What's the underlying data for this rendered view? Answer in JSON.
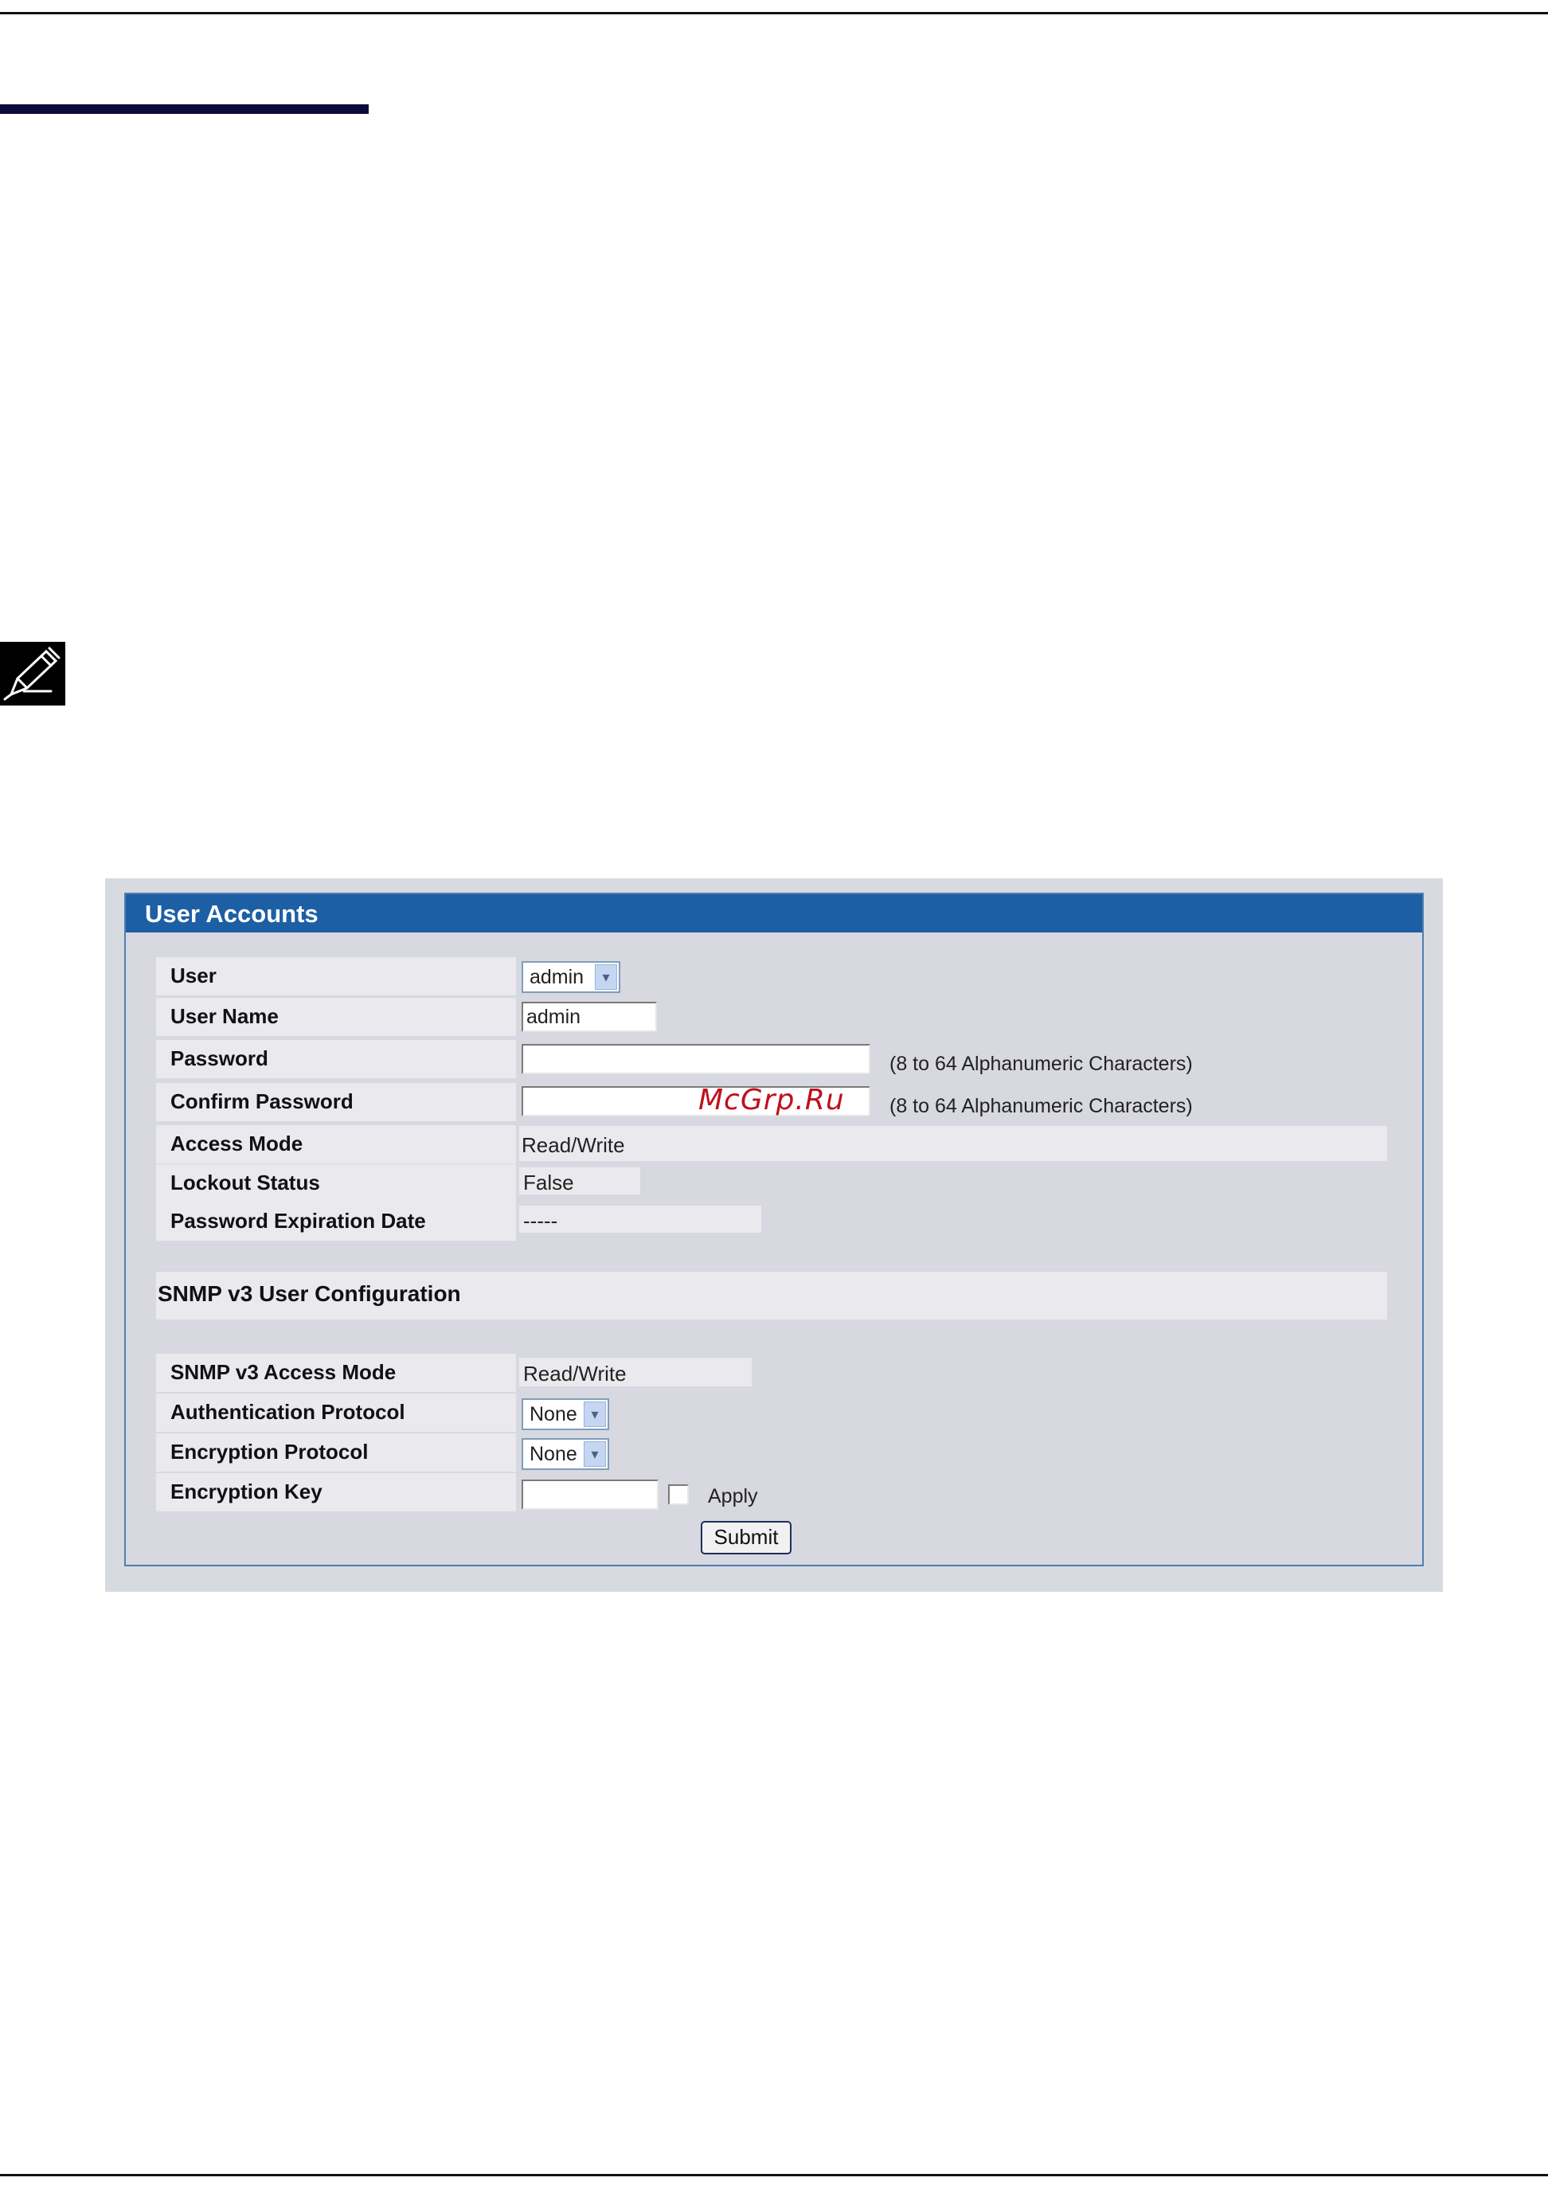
{
  "panel": {
    "title": "User Accounts"
  },
  "fields": {
    "user": {
      "label": "User",
      "selected": "admin"
    },
    "user_name": {
      "label": "User Name",
      "value": "admin"
    },
    "password": {
      "label": "Password",
      "value": "",
      "hint": "(8 to 64 Alphanumeric Characters)"
    },
    "confirm_password": {
      "label": "Confirm Password",
      "value": "",
      "hint": "(8 to 64 Alphanumeric Characters)"
    },
    "access_mode": {
      "label": "Access Mode",
      "value": "Read/Write"
    },
    "lockout_status": {
      "label": "Lockout Status",
      "value": "False"
    },
    "password_expiration_date": {
      "label": "Password Expiration Date",
      "value": "-----"
    }
  },
  "snmp": {
    "section_title": "SNMP v3 User Configuration",
    "access_mode": {
      "label": "SNMP v3 Access Mode",
      "value": "Read/Write"
    },
    "auth_protocol": {
      "label": "Authentication Protocol",
      "selected": "None"
    },
    "encryption_protocol": {
      "label": "Encryption Protocol",
      "selected": "None"
    },
    "encryption_key": {
      "label": "Encryption Key",
      "value": "",
      "apply_label": "Apply",
      "apply_checked": false
    }
  },
  "submit_label": "Submit",
  "watermark": "McGrp.Ru",
  "icons": {
    "note": "pencil-note-icon",
    "dropdown": "chevron-down-icon"
  },
  "colors": {
    "header": "#1d5fa4",
    "panel": "#d7d8e0",
    "section_bar": "#0b0b3c"
  }
}
